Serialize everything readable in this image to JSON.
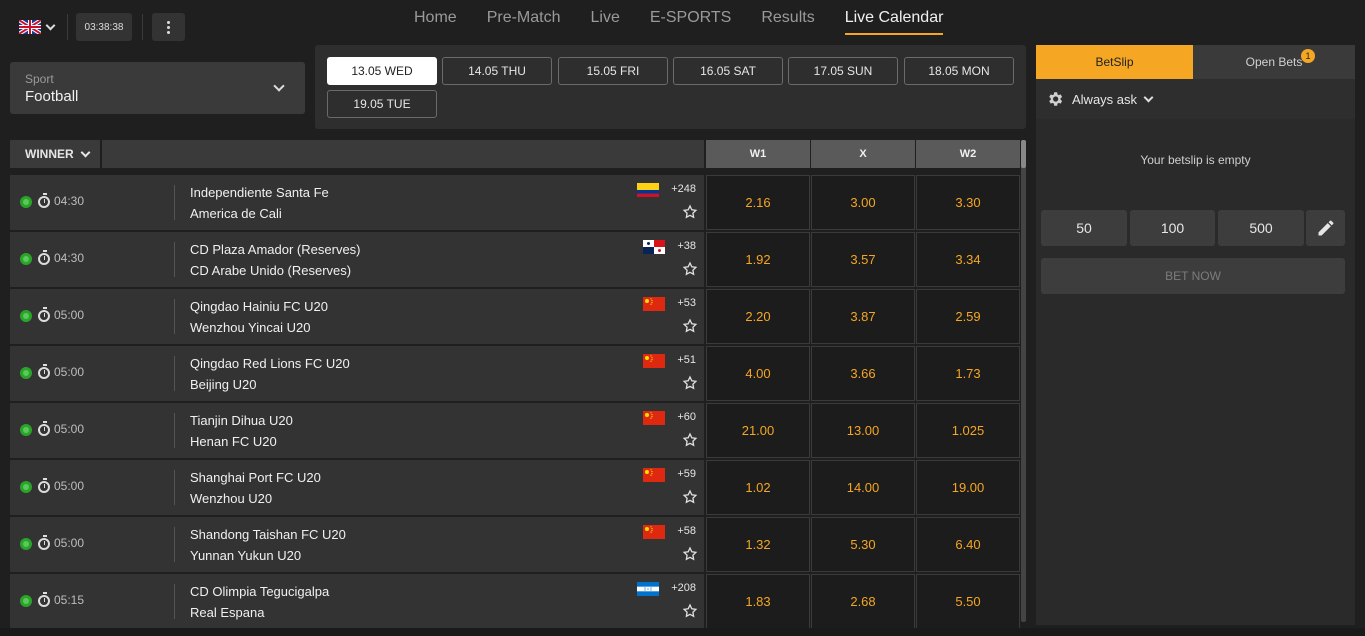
{
  "header": {
    "language_flag": "uk-flag-icon",
    "clock": "03:38:38",
    "nav": [
      "Home",
      "Pre-Match",
      "Live",
      "E-SPORTS",
      "Results",
      "Live Calendar"
    ],
    "active_nav": "Live Calendar"
  },
  "sport_filter": {
    "label": "Sport",
    "value": "Football"
  },
  "dates": [
    "13.05 WED",
    "14.05 THU",
    "15.05 FRI",
    "16.05 SAT",
    "17.05 SUN",
    "18.05 MON",
    "19.05 TUE"
  ],
  "active_date": "13.05 WED",
  "table": {
    "market_label": "WINNER",
    "columns": [
      "W1",
      "X",
      "W2"
    ],
    "rows": [
      {
        "time": "04:30",
        "team1": "Independiente Santa Fe",
        "team2": "America de Cali",
        "flag": "colombia",
        "count": "+248",
        "odds": [
          "2.16",
          "3.00",
          "3.30"
        ]
      },
      {
        "time": "04:30",
        "team1": "CD Plaza Amador (Reserves)",
        "team2": "CD Arabe Unido (Reserves)",
        "flag": "panama",
        "count": "+38",
        "odds": [
          "1.92",
          "3.57",
          "3.34"
        ]
      },
      {
        "time": "05:00",
        "team1": "Qingdao Hainiu FC U20",
        "team2": "Wenzhou Yincai U20",
        "flag": "china",
        "count": "+53",
        "odds": [
          "2.20",
          "3.87",
          "2.59"
        ]
      },
      {
        "time": "05:00",
        "team1": "Qingdao Red Lions FC U20",
        "team2": "Beijing U20",
        "flag": "china",
        "count": "+51",
        "odds": [
          "4.00",
          "3.66",
          "1.73"
        ]
      },
      {
        "time": "05:00",
        "team1": "Tianjin Dihua U20",
        "team2": "Henan FC U20",
        "flag": "china",
        "count": "+60",
        "odds": [
          "21.00",
          "13.00",
          "1.025"
        ]
      },
      {
        "time": "05:00",
        "team1": "Shanghai Port FC U20",
        "team2": "Wenzhou U20",
        "flag": "china",
        "count": "+59",
        "odds": [
          "1.02",
          "14.00",
          "19.00"
        ]
      },
      {
        "time": "05:00",
        "team1": "Shandong Taishan FC U20",
        "team2": "Yunnan Yukun U20",
        "flag": "china",
        "count": "+58",
        "odds": [
          "1.32",
          "5.30",
          "6.40"
        ]
      },
      {
        "time": "05:15",
        "team1": "CD Olimpia Tegucigalpa",
        "team2": "Real Espana",
        "flag": "honduras",
        "count": "+208",
        "odds": [
          "1.83",
          "2.68",
          "5.50"
        ]
      }
    ]
  },
  "betslip": {
    "tabs": [
      "BetSlip",
      "Open Bets"
    ],
    "open_bets_count": "1",
    "setting": "Always ask",
    "empty_message": "Your betslip is empty",
    "stakes": [
      "50",
      "100",
      "500"
    ],
    "bet_now": "BET NOW"
  },
  "colors": {
    "accent": "#f5a623",
    "background": "#1f1f1f",
    "row": "#333333",
    "odds_bg": "#1c1c1c"
  }
}
